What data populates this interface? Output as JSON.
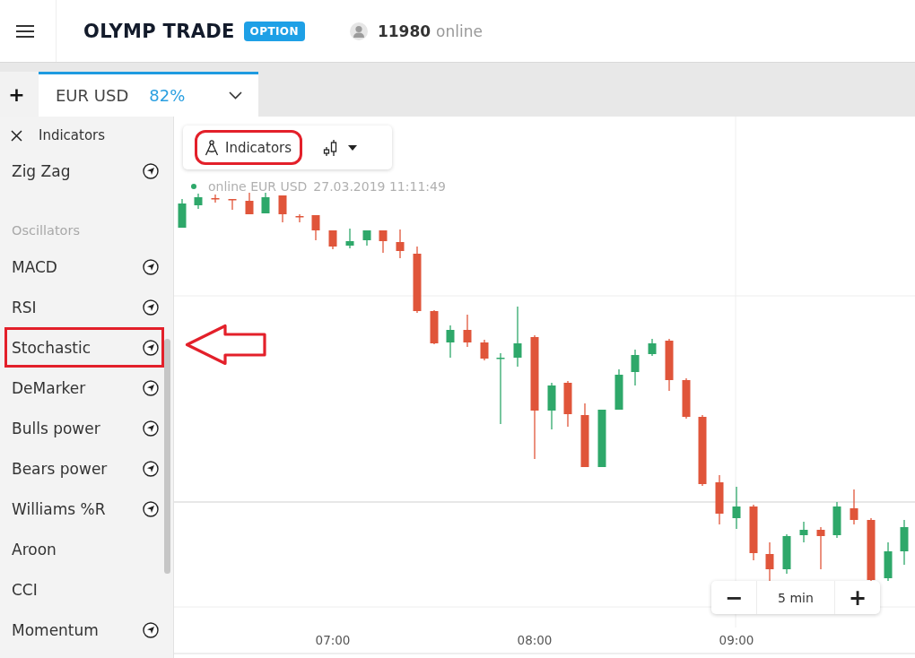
{
  "header": {
    "logo": "OLYMP TRADE",
    "badge": "OPTION",
    "online_count": "11980",
    "online_label": "online"
  },
  "tabs": {
    "add_label": "+",
    "items": [
      {
        "asset": "EUR USD",
        "payout": "82%",
        "selected": true
      }
    ]
  },
  "sidebar": {
    "title": "Indicators",
    "groups": [
      {
        "items": [
          {
            "name": "Zig Zag",
            "icon": true,
            "highlighted": false
          }
        ]
      },
      {
        "heading": "Oscillators",
        "items": [
          {
            "name": "MACD",
            "icon": true,
            "highlighted": false
          },
          {
            "name": "RSI",
            "icon": true,
            "highlighted": false
          },
          {
            "name": "Stochastic",
            "icon": true,
            "highlighted": true
          },
          {
            "name": "DeMarker",
            "icon": true,
            "highlighted": false
          },
          {
            "name": "Bulls power",
            "icon": true,
            "highlighted": false
          },
          {
            "name": "Bears power",
            "icon": true,
            "highlighted": false
          },
          {
            "name": "Williams %R",
            "icon": true,
            "highlighted": false
          },
          {
            "name": "Aroon",
            "icon": false,
            "highlighted": false
          },
          {
            "name": "CCI",
            "icon": false,
            "highlighted": false
          },
          {
            "name": "Momentum",
            "icon": true,
            "highlighted": false
          }
        ]
      }
    ]
  },
  "chart": {
    "toolbar": {
      "indicators_label": "Indicators",
      "highlighted": true
    },
    "status": "online EUR USD",
    "timestamp": "27.03.2019 11:11:49",
    "time_labels": [
      "07:00",
      "08:00",
      "09:00"
    ],
    "zoom": {
      "minus": "−",
      "value": "5 min",
      "plus": "+"
    }
  }
}
